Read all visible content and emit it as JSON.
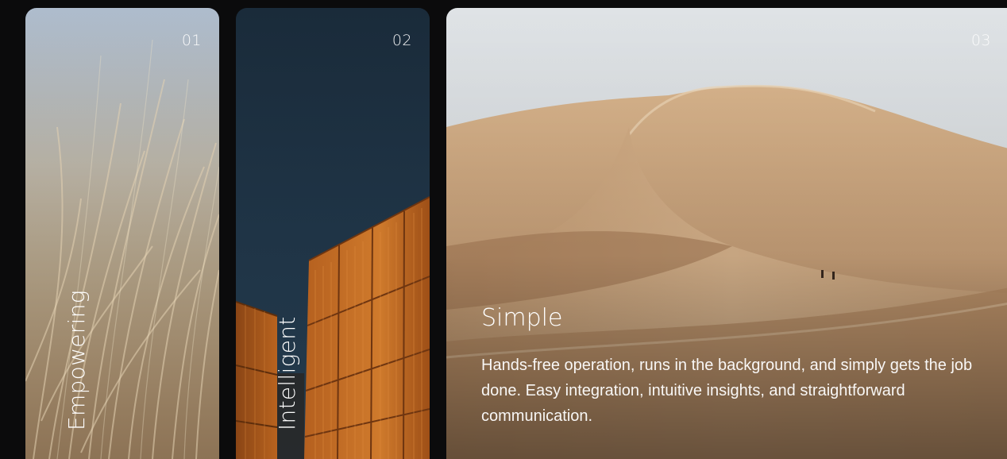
{
  "cards": [
    {
      "number": "01",
      "title": "Empowering",
      "icon": "wheat-grass-photo"
    },
    {
      "number": "02",
      "title": "Intelligent",
      "icon": "shipping-containers-photo"
    },
    {
      "number": "03",
      "title": "Simple",
      "description": "Hands-free operation, runs in the background, and simply gets the job done. Easy integration, intuitive insights, and straightforward communication.",
      "icon": "desert-dunes-photo"
    }
  ],
  "colors": {
    "background": "#0b0b0c",
    "text": "#ffffff"
  }
}
